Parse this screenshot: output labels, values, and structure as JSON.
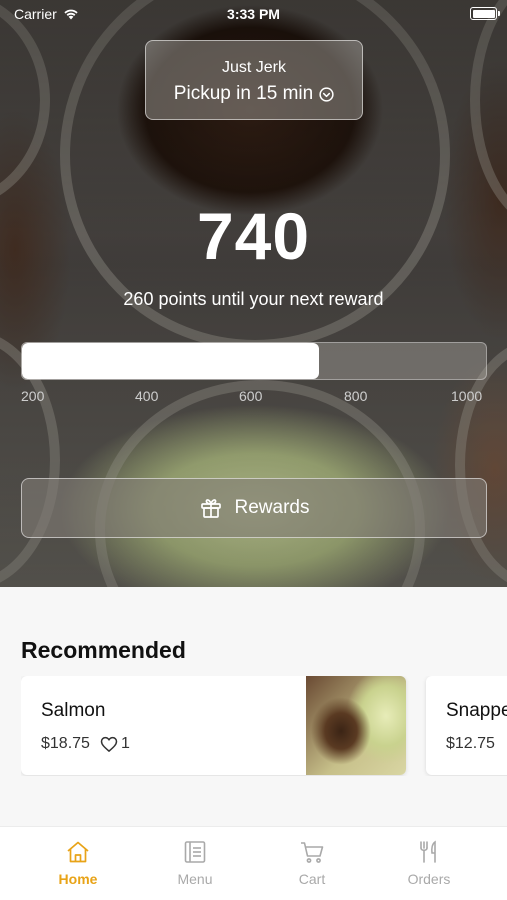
{
  "status_bar": {
    "carrier": "Carrier",
    "time": "3:33 PM"
  },
  "store": {
    "name": "Just Jerk",
    "pickup": "Pickup in 15 min"
  },
  "rewards": {
    "points": "740",
    "subtitle": "260 points until your next reward",
    "progress_value": 740,
    "scale_min": 100,
    "scale_max": 1100,
    "ticks": [
      "200",
      "400",
      "600",
      "800",
      "1000"
    ],
    "button_label": "Rewards"
  },
  "recommended": {
    "title": "Recommended",
    "items": [
      {
        "name": "Salmon",
        "price": "$18.75",
        "likes": "1"
      },
      {
        "name": "Snapper",
        "price": "$12.75"
      }
    ]
  },
  "tabs": [
    {
      "label": "Home",
      "icon": "home-icon",
      "active": true
    },
    {
      "label": "Menu",
      "icon": "menu-icon",
      "active": false
    },
    {
      "label": "Cart",
      "icon": "cart-icon",
      "active": false
    },
    {
      "label": "Orders",
      "icon": "fork-knife-icon",
      "active": false
    }
  ],
  "colors": {
    "accent": "#e8a317",
    "inactive_tab": "#a9a9a9"
  }
}
